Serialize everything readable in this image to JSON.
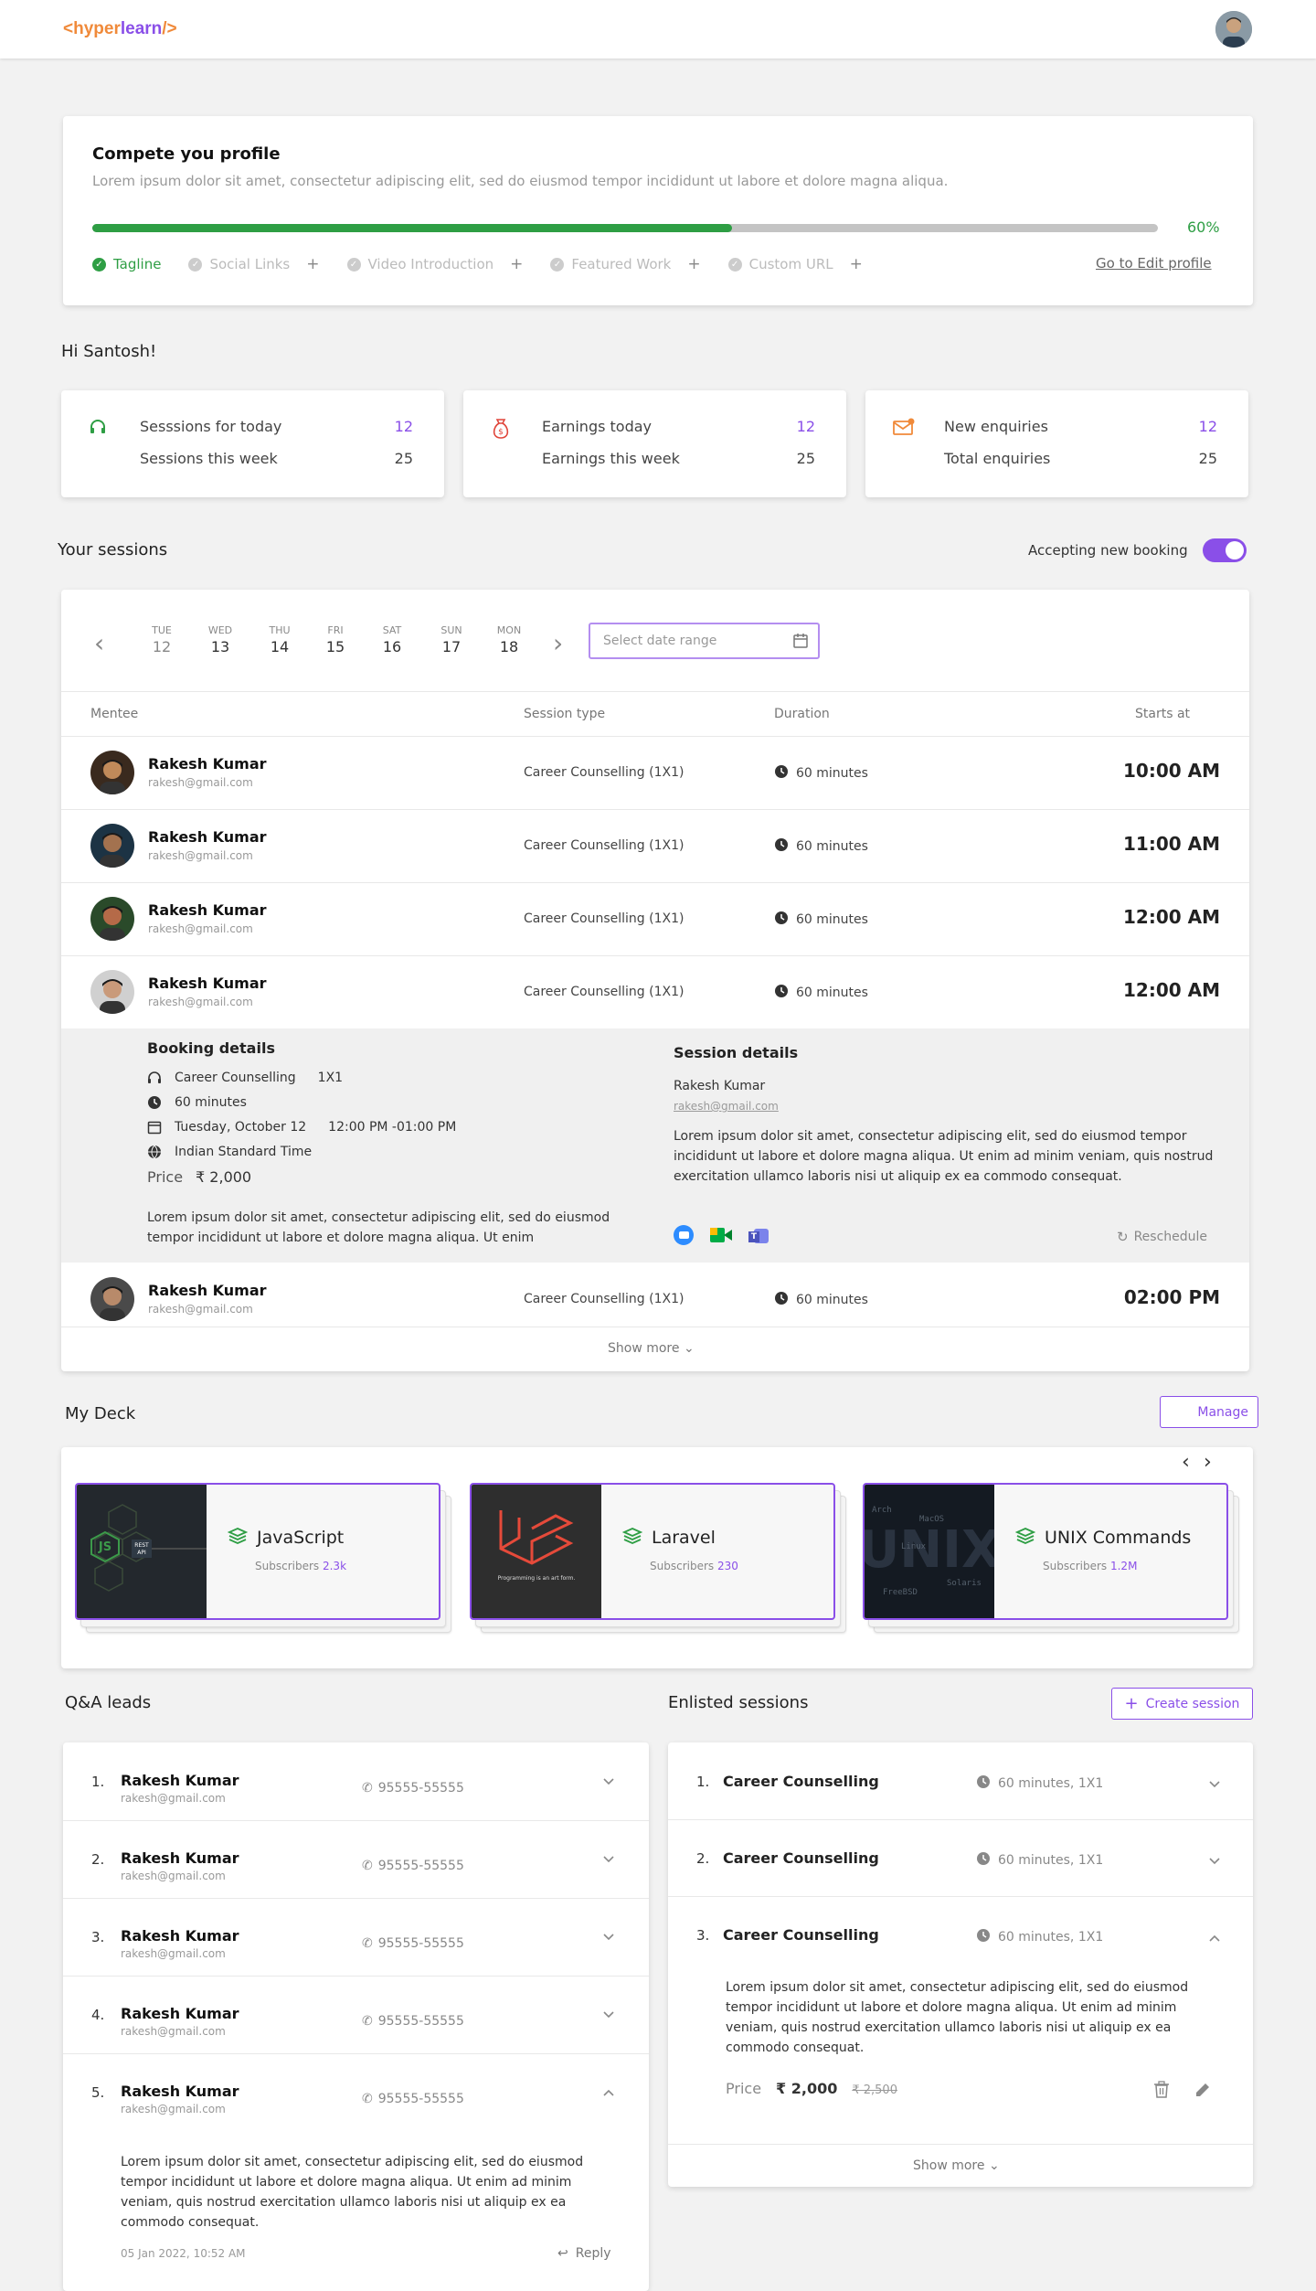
{
  "header": {
    "logo_open": "<",
    "logo_a": "hyper",
    "logo_b": "learn",
    "logo_close": "/>"
  },
  "profile": {
    "title": "Compete you profile",
    "description": "Lorem ipsum dolor sit amet, consectetur adipiscing elit, sed do eiusmod tempor incididunt ut labore et dolore magna aliqua.",
    "progress_pct": 60,
    "progress_label": "60%",
    "steps": [
      {
        "label": "Tagline",
        "done": true
      },
      {
        "label": "Social Links",
        "done": false
      },
      {
        "label": "Video Introduction",
        "done": false
      },
      {
        "label": "Featured Work",
        "done": false
      },
      {
        "label": "Custom URL",
        "done": false
      }
    ],
    "edit_link": "Go to Edit profile"
  },
  "greeting": "Hi Santosh!",
  "stats": [
    {
      "icon": "headset-icon",
      "l1": "Sesssions for today",
      "v1": "12",
      "l2": "Sessions this week",
      "v2": "25"
    },
    {
      "icon": "money-bag-icon",
      "l1": "Earnings today",
      "v1": "12",
      "l2": "Earnings this week",
      "v2": "25"
    },
    {
      "icon": "mail-icon",
      "l1": "New enquiries",
      "v1": "12",
      "l2": "Total enquiries",
      "v2": "25"
    }
  ],
  "sessions": {
    "title": "Your sessions",
    "booking_label": "Accepting new booking",
    "booking_on": true,
    "days": [
      {
        "d": "TUE",
        "n": "12"
      },
      {
        "d": "WED",
        "n": "13"
      },
      {
        "d": "THU",
        "n": "14"
      },
      {
        "d": "FRI",
        "n": "15"
      },
      {
        "d": "SAT",
        "n": "16"
      },
      {
        "d": "SUN",
        "n": "17"
      },
      {
        "d": "MON",
        "n": "18"
      }
    ],
    "date_placeholder": "Select date range",
    "columns": {
      "mentee": "Mentee",
      "type": "Session type",
      "duration": "Duration",
      "starts": "Starts at"
    },
    "rows": [
      {
        "name": "Rakesh Kumar",
        "email": "rakesh@gmail.com",
        "type": "Career Counselling (1X1)",
        "duration": "60 minutes",
        "time": "10:00 AM"
      },
      {
        "name": "Rakesh Kumar",
        "email": "rakesh@gmail.com",
        "type": "Career Counselling (1X1)",
        "duration": "60 minutes",
        "time": "11:00 AM"
      },
      {
        "name": "Rakesh Kumar",
        "email": "rakesh@gmail.com",
        "type": "Career Counselling (1X1)",
        "duration": "60 minutes",
        "time": "12:00 AM"
      },
      {
        "name": "Rakesh Kumar",
        "email": "rakesh@gmail.com",
        "type": "Career Counselling (1X1)",
        "duration": "60 minutes",
        "time": "12:00 AM"
      },
      {
        "name": "Rakesh Kumar",
        "email": "rakesh@gmail.com",
        "type": "Career Counselling (1X1)",
        "duration": "60 minutes",
        "time": "02:00 PM"
      }
    ],
    "booking": {
      "title": "Booking details",
      "type": "Career Counselling",
      "mode": "1X1",
      "duration": "60 minutes",
      "date": "Tuesday, October 12",
      "time": "12:00 PM -01:00 PM",
      "timezone": "Indian Standard Time",
      "price_label": "Price",
      "price": "₹ 2,000",
      "note": "Lorem ipsum dolor sit amet, consectetur adipiscing elit, sed do eiusmod tempor incididunt ut labore et dolore magna aliqua. Ut enim"
    },
    "session_details": {
      "title": "Session details",
      "name": "Rakesh Kumar",
      "email": "rakesh@gmail.com",
      "text": "Lorem ipsum dolor sit amet, consectetur adipiscing elit, sed do eiusmod tempor incididunt ut labore et dolore magna aliqua. Ut enim ad minim veniam, quis nostrud exercitation ullamco laboris nisi ut aliquip ex ea commodo consequat.",
      "reschedule": "Reschedule"
    },
    "show_more": "Show more"
  },
  "deck": {
    "title": "My Deck",
    "manage": "Manage",
    "items": [
      {
        "title": "JavaScript",
        "subs_label": "Subscribers",
        "subs": "2.3k",
        "img_text": "JS"
      },
      {
        "title": "Laravel",
        "subs_label": "Subscribers",
        "subs": "230",
        "img_text": "Programming is an art form."
      },
      {
        "title": "UNIX Commands",
        "subs_label": "Subscribers",
        "subs": "1.2M",
        "img_text": "UNIX"
      }
    ]
  },
  "qa": {
    "title": "Q&A leads",
    "rows": [
      {
        "num": "1.",
        "name": "Rakesh Kumar",
        "email": "rakesh@gmail.com",
        "phone": "95555-55555"
      },
      {
        "num": "2.",
        "name": "Rakesh Kumar",
        "email": "rakesh@gmail.com",
        "phone": "95555-55555"
      },
      {
        "num": "3.",
        "name": "Rakesh Kumar",
        "email": "rakesh@gmail.com",
        "phone": "95555-55555"
      },
      {
        "num": "4.",
        "name": "Rakesh Kumar",
        "email": "rakesh@gmail.com",
        "phone": "95555-55555"
      },
      {
        "num": "5.",
        "name": "Rakesh Kumar",
        "email": "rakesh@gmail.com",
        "phone": "95555-55555"
      }
    ],
    "expanded_text": "Lorem ipsum dolor sit amet, consectetur adipiscing elit, sed do eiusmod tempor incididunt ut labore et dolore magna aliqua. Ut enim ad minim veniam, quis nostrud exercitation ullamco laboris nisi ut aliquip ex ea commodo consequat.",
    "expanded_date": "05 Jan 2022, 10:52 AM",
    "reply": "Reply"
  },
  "enlisted": {
    "title": "Enlisted sessions",
    "create": "Create session",
    "rows": [
      {
        "num": "1.",
        "name": "Career Counselling",
        "meta": "60 minutes,  1X1"
      },
      {
        "num": "2.",
        "name": "Career Counselling",
        "meta": "60 minutes,  1X1"
      },
      {
        "num": "3.",
        "name": "Career Counselling",
        "meta": "60 minutes,  1X1"
      }
    ],
    "expanded_text": "Lorem ipsum dolor sit amet, consectetur adipiscing elit, sed do eiusmod tempor incididunt ut labore et dolore magna aliqua. Ut enim ad minim veniam, quis nostrud exercitation ullamco laboris nisi ut aliquip ex ea commodo consequat.",
    "price_label": "Price",
    "price": "₹ 2,000",
    "old_price": "₹ 2,500",
    "show_more": "Show more"
  },
  "colors": {
    "accent": "#8a4fe8",
    "success": "#2e9e44",
    "brand_orange": "#f08a3a"
  }
}
